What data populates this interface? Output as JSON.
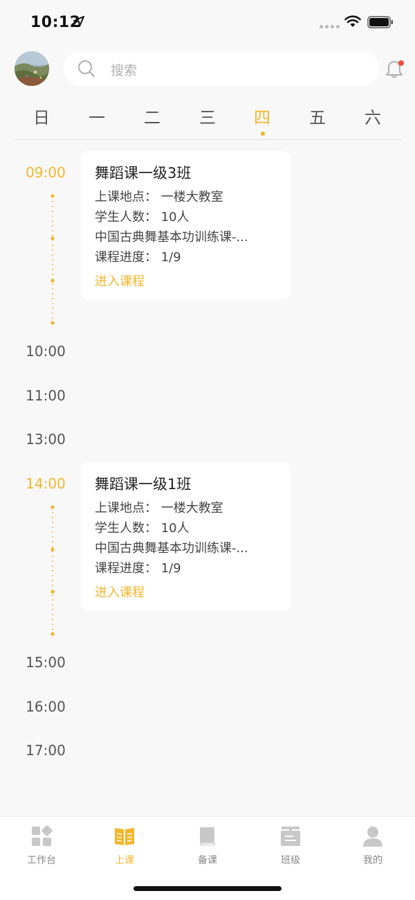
{
  "status": {
    "time": "10:12"
  },
  "search": {
    "placeholder": "搜索"
  },
  "week": {
    "days": [
      "日",
      "一",
      "二",
      "三",
      "四",
      "五",
      "六"
    ],
    "active_index": 4
  },
  "schedule": {
    "times": [
      "09:00",
      "10:00",
      "11:00",
      "13:00",
      "14:00",
      "15:00",
      "16:00",
      "17:00"
    ],
    "active_times": [
      "09:00",
      "14:00"
    ],
    "classes": [
      {
        "title": "舞蹈课一级3班",
        "location": "上课地点：  一楼大教室",
        "students": "学生人数：  10人",
        "course": "中国古典舞基本功训练课-...",
        "progress": "课程进度：  1/9",
        "link": "进入课程"
      },
      {
        "title": "舞蹈课一级1班",
        "location": "上课地点：  一楼大教室",
        "students": "学生人数：  10人",
        "course": "中国古典舞基本功训练课-...",
        "progress": "课程进度：  1/9",
        "link": "进入课程"
      }
    ]
  },
  "tabbar": {
    "items": [
      {
        "label": "工作台",
        "icon": "workbench-icon"
      },
      {
        "label": "上课",
        "icon": "class-book-icon"
      },
      {
        "label": "备课",
        "icon": "prepare-book-icon"
      },
      {
        "label": "班级",
        "icon": "class-board-icon"
      },
      {
        "label": "我的",
        "icon": "profile-icon"
      }
    ],
    "active_index": 1
  },
  "colors": {
    "accent": "#f4b52a",
    "badge": "#f24a3c",
    "background": "#f8f8f8"
  }
}
